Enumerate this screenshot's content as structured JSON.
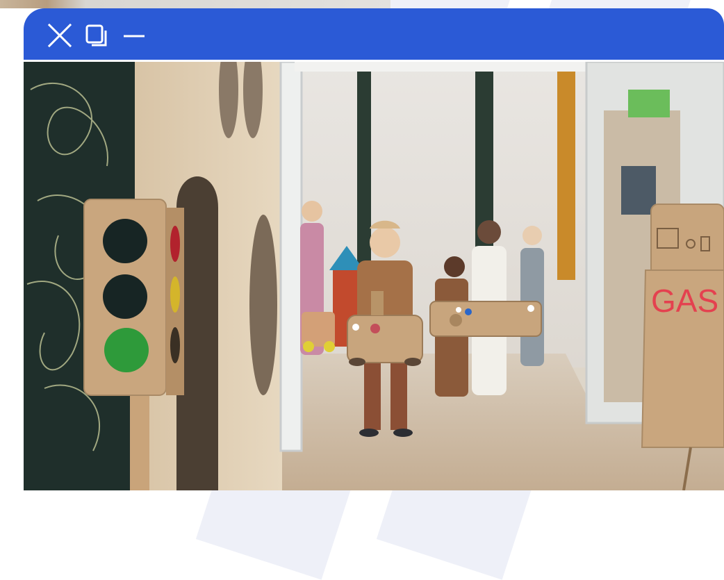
{
  "window": {
    "controls": [
      {
        "name": "close",
        "icon": "close-icon"
      },
      {
        "name": "restore",
        "icon": "restore-icon"
      },
      {
        "name": "minimize",
        "icon": "minimize-icon"
      }
    ],
    "titlebar_color": "#2b5ad6"
  },
  "photo": {
    "sign_text": "GAS"
  },
  "colors": {
    "accent": "#2b5ad6",
    "gas_text": "#e4414f",
    "light_green": "#2e9a3a"
  }
}
